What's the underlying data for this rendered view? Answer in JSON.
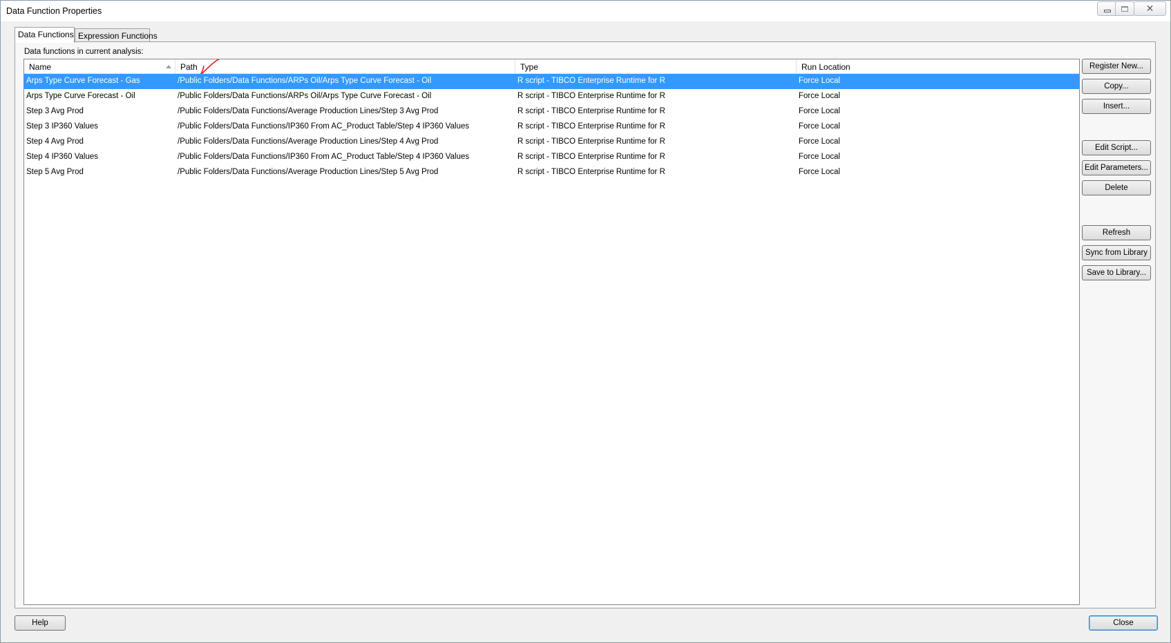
{
  "window": {
    "title": "Data Function Properties",
    "controls": {
      "minimize": "",
      "maximize": "",
      "close": "✕"
    }
  },
  "tabs": [
    {
      "label": "Data Functions",
      "active": true
    },
    {
      "label": "Expression Functions",
      "active": false
    }
  ],
  "section_label": "Data functions in current analysis:",
  "table": {
    "columns": [
      "Name",
      "Path",
      "Type",
      "Run Location"
    ],
    "sort_column": "Name",
    "sort_direction": "ascending",
    "rows": [
      {
        "name": "Arps Type Curve Forecast - Gas",
        "path": "/Public Folders/Data Functions/ARPs Oil/Arps Type Curve Forecast - Oil",
        "type": "R script - TIBCO Enterprise Runtime for R",
        "run_location": "Force Local",
        "selected": true
      },
      {
        "name": "Arps Type Curve Forecast - Oil",
        "path": "/Public Folders/Data Functions/ARPs Oil/Arps Type Curve Forecast - Oil",
        "type": "R script - TIBCO Enterprise Runtime for R",
        "run_location": "Force Local",
        "selected": false
      },
      {
        "name": "Step 3 Avg Prod",
        "path": "/Public Folders/Data Functions/Average Production Lines/Step 3 Avg Prod",
        "type": "R script - TIBCO Enterprise Runtime for R",
        "run_location": "Force Local",
        "selected": false
      },
      {
        "name": "Step 3 IP360 Values",
        "path": "/Public Folders/Data Functions/IP360 From AC_Product Table/Step 4 IP360 Values",
        "type": "R script - TIBCO Enterprise Runtime for R",
        "run_location": "Force Local",
        "selected": false
      },
      {
        "name": "Step 4 Avg Prod",
        "path": "/Public Folders/Data Functions/Average Production Lines/Step 4 Avg Prod",
        "type": "R script - TIBCO Enterprise Runtime for R",
        "run_location": "Force Local",
        "selected": false
      },
      {
        "name": "Step 4 IP360 Values",
        "path": "/Public Folders/Data Functions/IP360 From AC_Product Table/Step 4 IP360 Values",
        "type": "R script - TIBCO Enterprise Runtime for R",
        "run_location": "Force Local",
        "selected": false
      },
      {
        "name": "Step 5 Avg Prod",
        "path": "/Public Folders/Data Functions/Average Production Lines/Step 5 Avg Prod",
        "type": "R script - TIBCO Enterprise Runtime for R",
        "run_location": "Force Local",
        "selected": false
      }
    ]
  },
  "side_buttons": {
    "register_new": "Register New...",
    "copy": "Copy...",
    "insert": "Insert...",
    "edit_script": "Edit Script...",
    "edit_parameters": "Edit Parameters...",
    "delete": "Delete",
    "refresh": "Refresh",
    "sync_from_library": "Sync from Library",
    "save_to_library": "Save to Library..."
  },
  "footer": {
    "help": "Help",
    "close": "Close"
  },
  "colors": {
    "selection": "#3399ff",
    "annotation": "#e8191c"
  }
}
